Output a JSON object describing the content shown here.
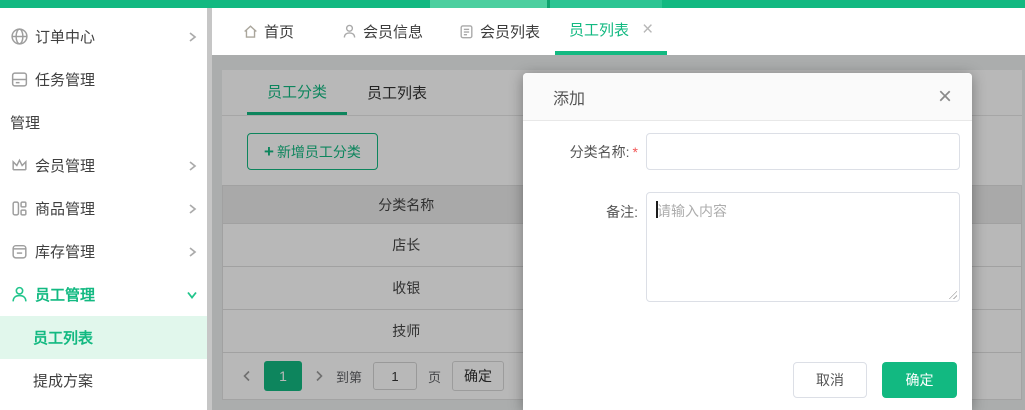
{
  "colors": {
    "green": "#12b981",
    "green-dark": "#0ea36e",
    "strip-seg1": "#4ccf9f",
    "strip-seg2": "#2cc593",
    "active-item-bg": "#e1f7ec",
    "required-red": "#f25555"
  },
  "sidebar": {
    "items": [
      {
        "label": "订单中心",
        "icon": "globe-icon"
      },
      {
        "label": "任务管理",
        "icon": "task-icon"
      },
      {
        "label": "管理",
        "icon": ""
      },
      {
        "label": "会员管理",
        "icon": "crown-icon"
      },
      {
        "label": "商品管理",
        "icon": "goods-icon"
      },
      {
        "label": "库存管理",
        "icon": "inventory-icon"
      },
      {
        "label": "员工管理",
        "icon": "employee-icon"
      },
      {
        "label": "员工列表",
        "icon": ""
      },
      {
        "label": "提成方案",
        "icon": ""
      }
    ]
  },
  "nav": {
    "tabs": [
      {
        "label": "首页",
        "icon": "home-icon"
      },
      {
        "label": "会员信息",
        "icon": "member-icon"
      },
      {
        "label": "会员列表",
        "icon": "list-icon"
      },
      {
        "label": "员工列表",
        "close": "×"
      }
    ]
  },
  "content": {
    "tabs": [
      {
        "label": "员工分类"
      },
      {
        "label": "员工列表"
      }
    ],
    "add_button": {
      "plus": "+",
      "label": "新增员工分类"
    },
    "table": {
      "header": "分类名称",
      "rows": [
        "店长",
        "收银",
        "技师"
      ]
    },
    "pagination": {
      "current_page": "1",
      "goto_label": "到第",
      "page_value": "1",
      "page_unit": "页",
      "confirm_label": "确定"
    }
  },
  "modal": {
    "title": "添加",
    "close_glyph": "×",
    "name_label": "分类名称:",
    "required_mark": "*",
    "name_value": "",
    "remark_label": "备注:",
    "remark_placeholder": "请输入内容",
    "cancel_label": "取消",
    "confirm_label": "确定"
  }
}
